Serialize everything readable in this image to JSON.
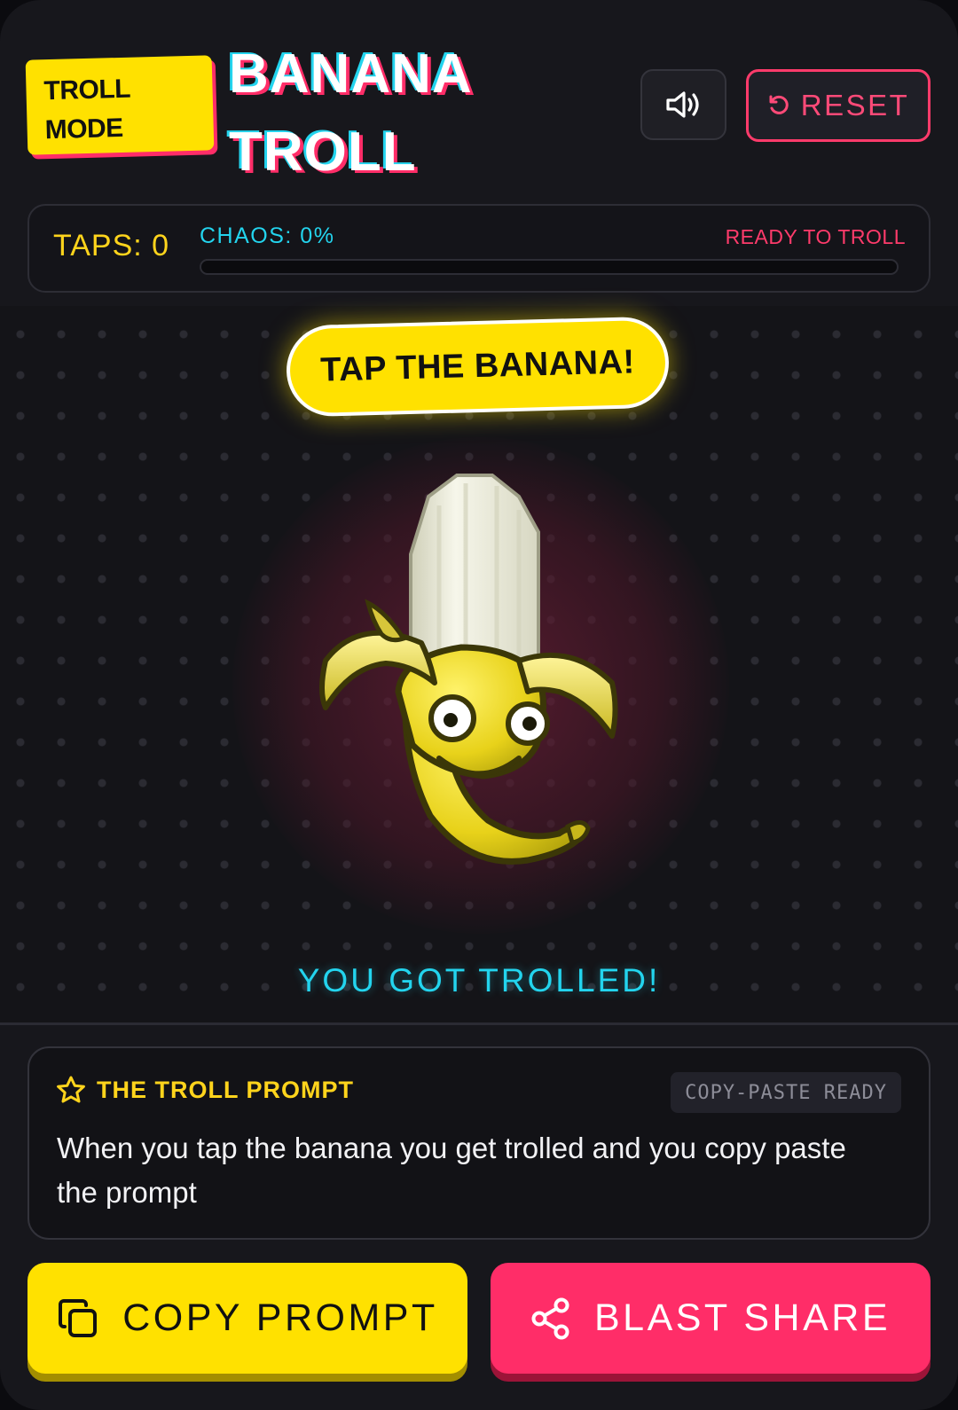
{
  "header": {
    "badge_line1": "TROLL",
    "badge_line2": "MODE",
    "title_line1": "BANANA",
    "title_line2": "TROLL",
    "sound_icon": "speaker-icon",
    "reset_label": "RESET",
    "reset_icon": "reset-icon"
  },
  "stats": {
    "taps_label": "TAPS: 0",
    "chaos_label": "CHAOS: 0%",
    "chaos_percent": 0,
    "status": "READY TO TROLL"
  },
  "stage": {
    "banner": "TAP THE BANANA!",
    "caption": "YOU GOT TROLLED!"
  },
  "prompt": {
    "icon": "star-icon",
    "title": "THE TROLL PROMPT",
    "badge": "COPY-PASTE READY",
    "text": "When you tap the banana you get trolled and you copy paste the prompt"
  },
  "actions": {
    "copy_label": "COPY PROMPT",
    "copy_icon": "copy-icon",
    "share_label": "BLAST SHARE",
    "share_icon": "share-icon"
  },
  "colors": {
    "accent_yellow": "#ffe100",
    "accent_pink": "#ff2d68",
    "accent_cyan": "#23d4ee",
    "background": "#17171c"
  }
}
